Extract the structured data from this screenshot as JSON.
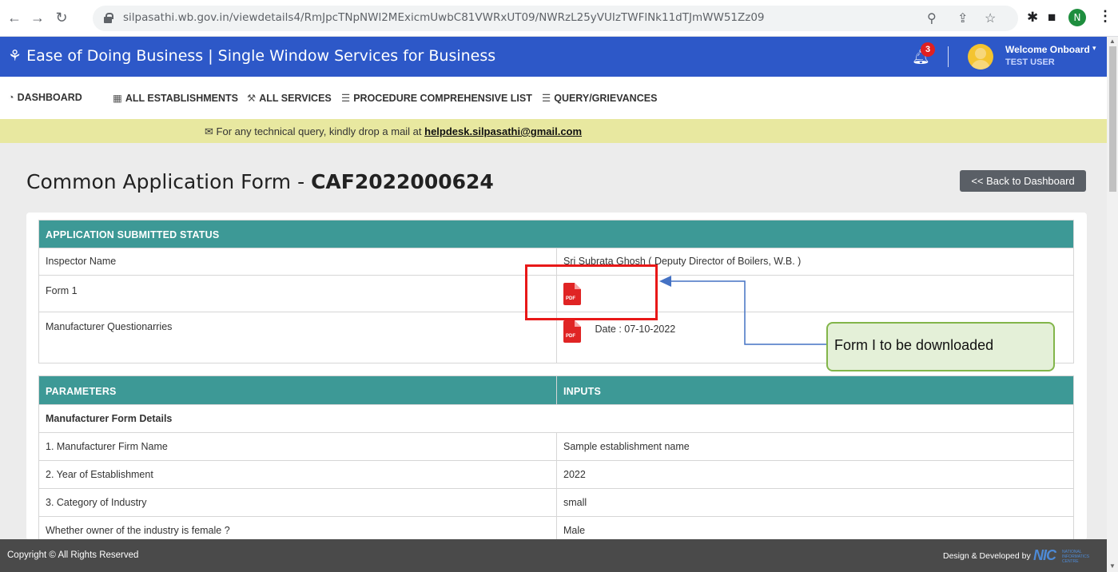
{
  "browser": {
    "url": "silpasathi.wb.gov.in/viewdetails4/RmJpcTNpNWl2MExicmUwbC81VWRxUT09/NWRzL25yVUIzTWFlNk11dTJmWW51Zz09",
    "profile_initial": "N"
  },
  "header": {
    "title": "Ease of Doing Business | Single Window Services for Business",
    "notification_count": "3",
    "welcome": "Welcome Onboard",
    "user": "TEST USER"
  },
  "nav": {
    "dashboard": "DASHBOARD",
    "establishments": "ALL ESTABLISHMENTS",
    "services": "ALL SERVICES",
    "procedure": "PROCEDURE COMPREHENSIVE LIST",
    "query": "QUERY/GRIEVANCES"
  },
  "notice": {
    "text": "For any technical query, kindly drop a mail at ",
    "email": "helpdesk.silpasathi@gmail.com"
  },
  "page": {
    "title_prefix": "Common Application Form - ",
    "caf_id": "CAF2022000624",
    "back_label": "<< Back to Dashboard"
  },
  "status_table": {
    "header": "APPLICATION SUBMITTED STATUS",
    "rows": [
      {
        "label": "Inspector Name",
        "value": "Sri Subrata Ghosh ( Deputy Director of Boilers, W.B. )"
      },
      {
        "label": "Form 1",
        "value": ""
      },
      {
        "label": "Manufacturer Questionarries",
        "value": "Date : 07-10-2022"
      }
    ],
    "pdf_label": "PDF"
  },
  "params_table": {
    "col1": "PARAMETERS",
    "col2": "INPUTS",
    "section": "Manufacturer Form Details",
    "rows": [
      {
        "label": "1. Manufacturer Firm Name",
        "value": "Sample establishment name"
      },
      {
        "label": "2. Year of Establishment",
        "value": "2022"
      },
      {
        "label": "3. Category of Industry",
        "value": "small"
      },
      {
        "label": "Whether owner of the industry is female ?",
        "value": "Male"
      }
    ]
  },
  "annotation": {
    "callout": "Form I to be downloaded"
  },
  "footer": {
    "copyright": "Copyright © All Rights Reserved",
    "designed": "Design & Developed by",
    "nic": "NIC",
    "nic_sub": "NATIONAL INFORMATICS CENTRE"
  },
  "colors": {
    "header_bg": "#2d58c8",
    "table_header": "#3d9996",
    "notice_bg": "#e8e8a0",
    "annotation_red": "#e81818",
    "callout_green": "#82b54a"
  }
}
